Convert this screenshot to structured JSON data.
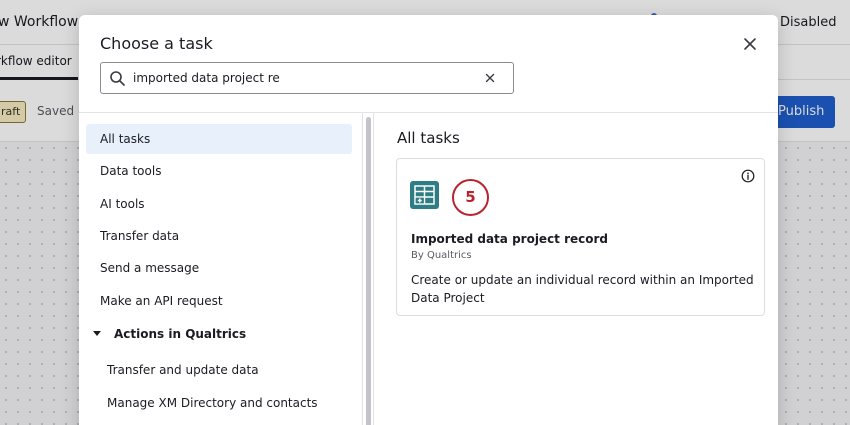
{
  "background": {
    "window_title": "w Workflow",
    "status": "Disabled",
    "tab_label": "rkflow editor",
    "draft_badge": "raft",
    "saved_label": "Saved (",
    "publish_label": "Publish"
  },
  "modal": {
    "title": "Choose a task",
    "search": {
      "value": "imported data project re",
      "placeholder": ""
    },
    "nav": {
      "items": [
        {
          "label": "All tasks",
          "active": true
        },
        {
          "label": "Data tools"
        },
        {
          "label": "AI tools"
        },
        {
          "label": "Transfer data"
        },
        {
          "label": "Send a message"
        },
        {
          "label": "Make an API request"
        }
      ],
      "section": {
        "label": "Actions in Qualtrics",
        "children": [
          {
            "label": "Transfer and update data"
          },
          {
            "label": "Manage XM Directory and contacts"
          }
        ]
      }
    },
    "panel_title": "All tasks",
    "task": {
      "name": "Imported data project record",
      "provider": "By Qualtrics",
      "description": "Create or update an individual record within an Imported Data Project",
      "step": "5",
      "icon": "table-add-icon"
    }
  },
  "colors": {
    "accent": "#1f5fcf",
    "task_icon_bg": "#2e7c84",
    "step_badge": "#b8232f",
    "active_nav_bg": "#e8f0fb"
  }
}
